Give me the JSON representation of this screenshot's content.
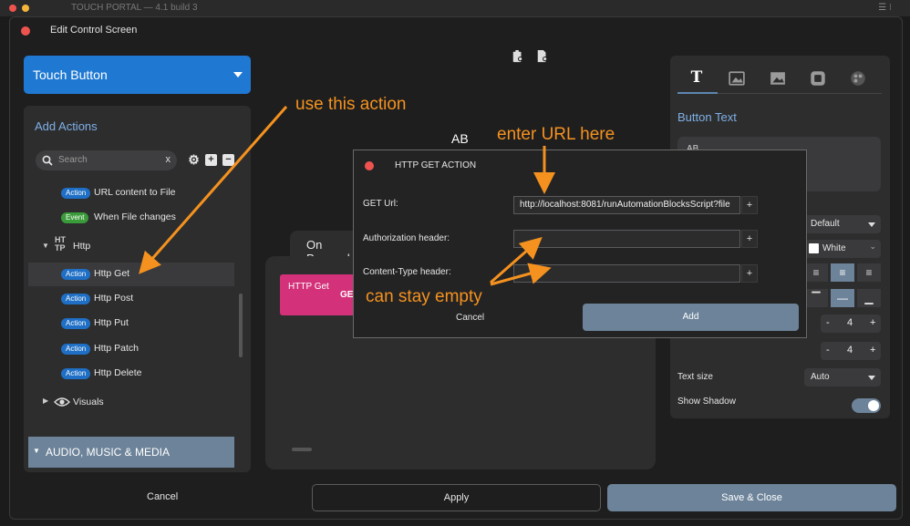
{
  "back_app": {
    "title": "TOUCH PORTAL — 4.1 build 3"
  },
  "window": {
    "title": "Edit Control Screen"
  },
  "touch_button": {
    "label": "Touch Button"
  },
  "add_actions": {
    "title": "Add Actions",
    "search_placeholder": "Search",
    "search_clear": "x",
    "items": [
      {
        "badge": "Action",
        "label": "URL content to File"
      },
      {
        "badge": "Event",
        "label": "When File changes"
      }
    ],
    "http_group": {
      "label": "Http"
    },
    "http_items": [
      {
        "badge": "Action",
        "label": "Http Get"
      },
      {
        "badge": "Action",
        "label": "Http Post"
      },
      {
        "badge": "Action",
        "label": "Http Put"
      },
      {
        "badge": "Action",
        "label": "Http Patch"
      },
      {
        "badge": "Action",
        "label": "Http Delete"
      }
    ],
    "visuals_group": {
      "label": "Visuals"
    },
    "audio_section": {
      "label": "AUDIO, MUSIC & MEDIA"
    }
  },
  "center": {
    "ab_label": "AB",
    "on_pressed_tab": "On Pressed",
    "http_card": {
      "title": "HTTP Get",
      "suffix": "GET"
    }
  },
  "right_panel": {
    "button_text_label": "Button Text",
    "text_value": "AB",
    "font_select": "Default",
    "color_select": "White",
    "stepper_a": "4",
    "stepper_b": "4",
    "text_size_label": "Text size",
    "text_size_select": "Auto",
    "show_shadow_label": "Show Shadow",
    "show_shadow_on": true
  },
  "dialog": {
    "title": "HTTP GET ACTION",
    "get_url_label": "GET Url:",
    "get_url_value": "http://localhost:8081/runAutomationBlocksScript?file",
    "auth_label": "Authorization header:",
    "auth_value": "",
    "content_type_label": "Content-Type header:",
    "content_type_value": "",
    "plus": "+",
    "cancel": "Cancel",
    "add": "Add"
  },
  "bottom": {
    "cancel": "Cancel",
    "apply": "Apply",
    "save_close": "Save & Close"
  },
  "annotations": {
    "use_this_action": "use this action",
    "enter_url_here": "enter URL here",
    "can_stay_empty": "can stay empty",
    "color": "#f5921f"
  },
  "icons": [
    "search-icon",
    "gear-icon",
    "plus-box-icon",
    "minus-box-icon",
    "http-icon",
    "eye-icon",
    "clipboard-icon",
    "text-icon",
    "image-icon",
    "close-dot-icon"
  ]
}
